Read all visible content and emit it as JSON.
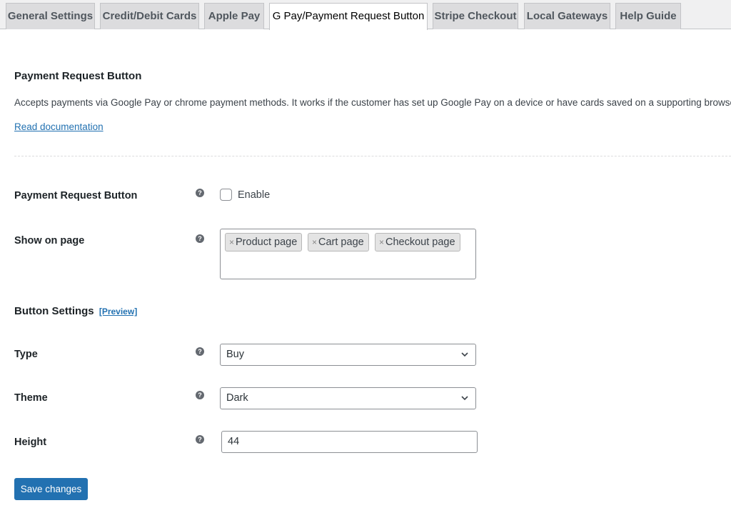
{
  "tabs": [
    {
      "label": "General Settings",
      "active": false
    },
    {
      "label": "Credit/Debit Cards",
      "active": false
    },
    {
      "label": "Apple Pay",
      "active": false
    },
    {
      "label": "G Pay/Payment Request Button",
      "active": true
    },
    {
      "label": "Stripe Checkout",
      "active": false
    },
    {
      "label": "Local Gateways",
      "active": false
    },
    {
      "label": "Help Guide",
      "active": false
    }
  ],
  "section": {
    "title": "Payment Request Button",
    "description": "Accepts payments via Google Pay or chrome payment methods. It works if the customer has set up Google Pay on a device or have cards saved on a supporting browser.",
    "doc_link": "Read documentation"
  },
  "fields": {
    "payment_request_button": {
      "label": "Payment Request Button",
      "checkbox_label": "Enable",
      "checked": false,
      "help_icon": "question-circle-icon"
    },
    "show_on_page": {
      "label": "Show on page",
      "selected": [
        "Product page",
        "Cart page",
        "Checkout page"
      ],
      "remove_glyph": "×",
      "help_icon": "question-circle-icon"
    }
  },
  "button_settings": {
    "title": "Button Settings",
    "preview_link": "[Preview]",
    "type": {
      "label": "Type",
      "value": "Buy"
    },
    "theme": {
      "label": "Theme",
      "value": "Dark"
    },
    "height": {
      "label": "Height",
      "value": "44"
    }
  },
  "help_glyph": "?",
  "save_button": "Save changes",
  "colors": {
    "accent": "#2271b1",
    "tab_inactive": "#dcdcde",
    "tab_bar": "#f0f0f1"
  }
}
